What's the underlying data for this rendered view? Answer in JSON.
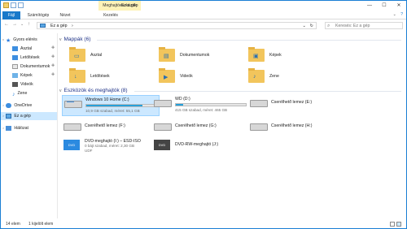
{
  "window": {
    "title": "Ez a gép",
    "context_tab": "Meghajtóeszközök",
    "min": "—",
    "max": "☐",
    "close": "✕"
  },
  "ribbon": {
    "tabs": [
      "Fájl",
      "Számítógép",
      "Nézet",
      "Kezelés"
    ],
    "expand": "⌄",
    "help": "?"
  },
  "address": {
    "back": "←",
    "forward": "→",
    "up": "↑",
    "path": "Ez a gép",
    "sep": "›",
    "dropdown": "⌄",
    "refresh": "↻",
    "search_placeholder": "Keresés: Ez a gép"
  },
  "sidebar": {
    "quick_access": "Gyors elérés",
    "items": [
      "Asztal",
      "Letöltések",
      "Dokumentumok",
      "Képek",
      "Videók",
      "Zene"
    ],
    "onedrive": "OneDrive",
    "this_pc": "Ez a gép",
    "network": "Hálózat"
  },
  "folders_group": "Mappák (6)",
  "folders": [
    "Asztal",
    "Dokumentumok",
    "Képek",
    "Letöltések",
    "Videók",
    "Zene"
  ],
  "drives_group": "Eszközök és meghajtók (8)",
  "drives": [
    {
      "name": "Windows 10 Home (C:)",
      "detail": "10,9 GB szabad, méret: 55,1 GB",
      "used": 0.8
    },
    {
      "name": "WD (D:)",
      "detail": "415 GB szabad, méret: 465 GB",
      "used": 0.11
    },
    {
      "name": "Cserélhető lemez (E:)"
    },
    {
      "name": "Cserélhető lemez (F:)"
    },
    {
      "name": "Cserélhető lemez (G:)"
    },
    {
      "name": "Cserélhető lemez (H:)"
    },
    {
      "name": "DVD-meghajtó (I:) – ESD-ISO",
      "detail": "0 bájt szabad, méret: 2,30 GB",
      "detail2": "UDF"
    },
    {
      "name": "DVD-RW-meghajtó (J:)"
    }
  ],
  "status": {
    "count": "14 elem",
    "selected": "1 kijelölt elem"
  }
}
